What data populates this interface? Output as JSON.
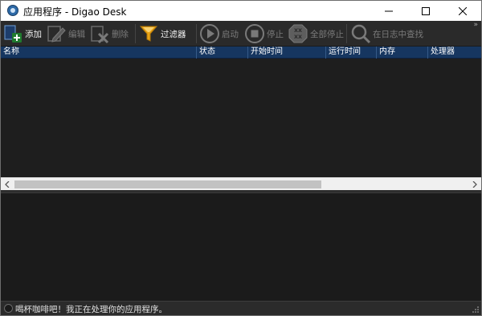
{
  "window": {
    "title": "应用程序 - Digao Desk",
    "icon": "app-icon"
  },
  "toolbar": {
    "add_label": "添加",
    "edit_label": "编辑",
    "delete_label": "删除",
    "filter_label": "过滤器",
    "start_label": "启动",
    "stop_label": "停止",
    "stop_all_label": "全部停止",
    "find_in_log_label": "在日志中查找",
    "overflow_label": "»"
  },
  "grid": {
    "columns": [
      "名称",
      "状态",
      "开始时间",
      "运行时间",
      "内存",
      "处理器"
    ],
    "rows": []
  },
  "statusbar": {
    "message": "喝杯咖啡吧！我正在处理你的应用程序。"
  },
  "colors": {
    "header_bg": "#163660",
    "toolbar_bg": "#2a2a2a",
    "grid_bg": "#1e1e1e",
    "enabled_text": "#f0f0f0",
    "disabled_text": "#7b7b7b"
  }
}
